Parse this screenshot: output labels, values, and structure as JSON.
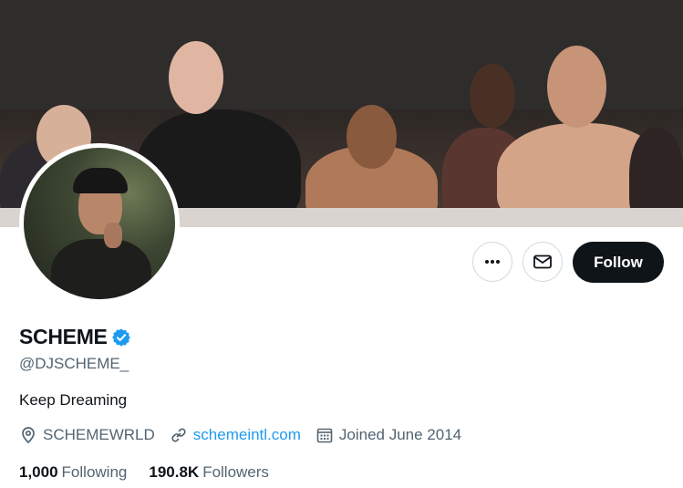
{
  "profile": {
    "display_name": "SCHEME",
    "handle": "@DJSCHEME_",
    "bio": "Keep Dreaming",
    "location": "SCHEMEWRLD",
    "website": "schemeintl.com",
    "joined": "Joined June 2014",
    "verified": true
  },
  "actions": {
    "more_icon": "more-horizontal-icon",
    "message_icon": "envelope-icon",
    "follow_label": "Follow"
  },
  "stats": {
    "following_count": "1,000",
    "following_label": "Following",
    "followers_count": "190.8K",
    "followers_label": "Followers"
  },
  "icons": {
    "location": "location-pin-icon",
    "link": "link-icon",
    "calendar": "calendar-icon",
    "verified": "verified-badge-icon"
  },
  "colors": {
    "accent": "#1d9bf0",
    "text_primary": "#0f1419",
    "text_secondary": "#536471",
    "follow_button_bg": "#0f1419",
    "border": "#cfd9de"
  }
}
